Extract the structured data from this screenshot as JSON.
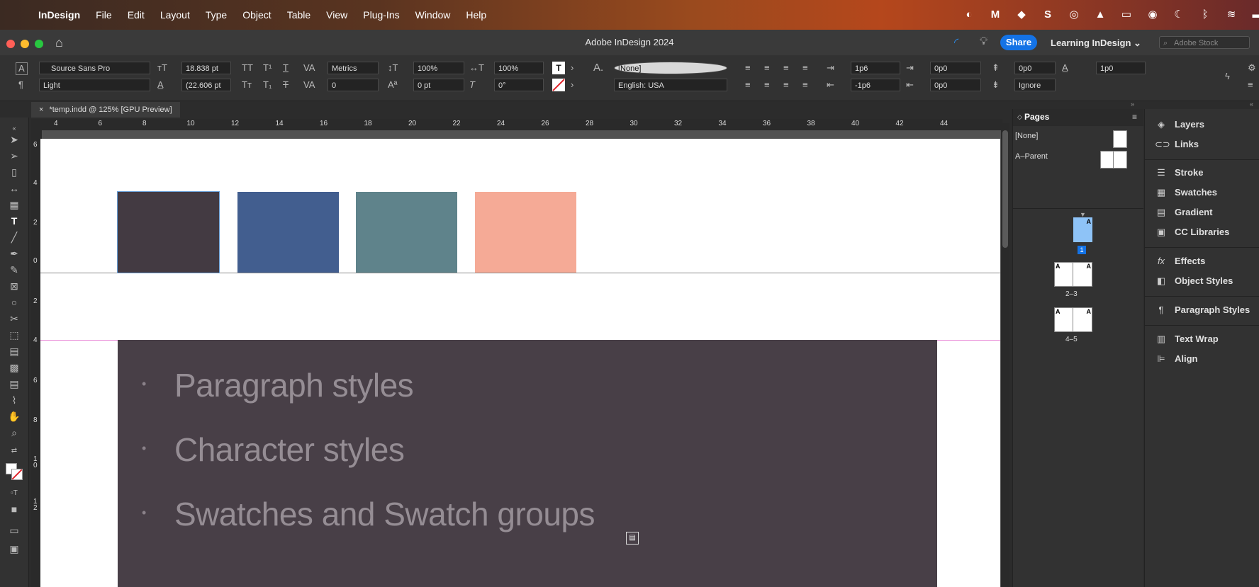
{
  "menubar": {
    "app": "InDesign",
    "items": [
      "File",
      "Edit",
      "Layout",
      "Type",
      "Object",
      "Table",
      "View",
      "Plug-Ins",
      "Window",
      "Help"
    ]
  },
  "titlebar": {
    "title": "Adobe InDesign 2024",
    "share": "Share",
    "workspace": "Learning InDesign",
    "stock_placeholder": "Adobe Stock"
  },
  "control": {
    "font_family": "Source Sans Pro",
    "font_style": "Light",
    "font_size": "18.838 pt",
    "leading": "(22.606 pt",
    "kerning": "Metrics",
    "tracking": "0",
    "vscale": "100%",
    "hscale": "100%",
    "baseline": "0 pt",
    "skew": "0°",
    "char_style": "[None]",
    "language": "English: USA",
    "left_indent": "1p6",
    "first_indent": "-1p6",
    "right_indent": "0p0",
    "last_indent": "0p0",
    "space_before": "0p0",
    "space_after": "0p0",
    "dropcap": "1p0",
    "grid_align": "Ignore"
  },
  "document": {
    "tab": "*temp.indd @ 125% [GPU Preview]"
  },
  "ruler": {
    "h": [
      "4",
      "6",
      "8",
      "10",
      "12",
      "14",
      "16",
      "18",
      "20",
      "22",
      "24",
      "26",
      "28",
      "30",
      "32",
      "34",
      "36",
      "38",
      "40",
      "42",
      "44"
    ],
    "v": [
      "6",
      "4",
      "2",
      "0",
      "2",
      "4",
      "6",
      "8",
      "1\n0",
      "1\n2"
    ]
  },
  "swatches": {
    "colors": [
      "#433a42",
      "#425e8f",
      "#5f838b",
      "#f5aa96"
    ]
  },
  "content": {
    "items": [
      "Paragraph styles",
      "Character styles",
      "Swatches and Swatch groups"
    ],
    "bullet": "•"
  },
  "pages_panel": {
    "title": "Pages",
    "none": "[None]",
    "parent": "A–Parent",
    "page1": "1",
    "spread2": "2–3",
    "spread3": "4–5",
    "parent_letter": "A"
  },
  "right_panels": [
    {
      "icon": "layers-icon",
      "glyph": "◈",
      "label": "Layers"
    },
    {
      "icon": "links-icon",
      "glyph": "⊂⊃",
      "label": "Links"
    },
    {
      "icon": "stroke-icon",
      "glyph": "☰",
      "label": "Stroke"
    },
    {
      "icon": "swatches-icon",
      "glyph": "▦",
      "label": "Swatches"
    },
    {
      "icon": "gradient-icon",
      "glyph": "▤",
      "label": "Gradient"
    },
    {
      "icon": "cc-libraries-icon",
      "glyph": "▣",
      "label": "CC Libraries"
    },
    {
      "icon": "effects-icon",
      "glyph": "fx",
      "label": "Effects"
    },
    {
      "icon": "object-styles-icon",
      "glyph": "◧",
      "label": "Object Styles"
    },
    {
      "icon": "paragraph-styles-icon",
      "glyph": "¶",
      "label": "Paragraph Styles"
    },
    {
      "icon": "text-wrap-icon",
      "glyph": "▥",
      "label": "Text Wrap"
    },
    {
      "icon": "align-icon",
      "glyph": "⊫",
      "label": "Align"
    }
  ]
}
